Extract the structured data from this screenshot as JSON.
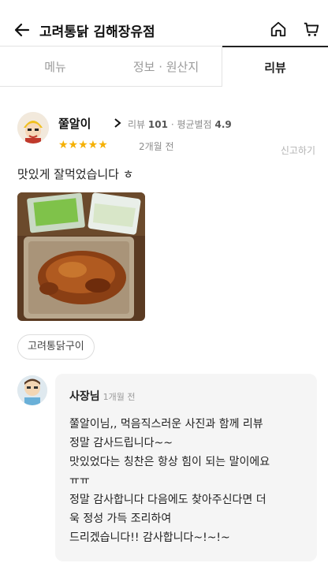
{
  "header": {
    "title": "고려통닭 김해장유점"
  },
  "tabs": [
    {
      "label": "메뉴"
    },
    {
      "label": "정보 · 원산지"
    },
    {
      "label": "리뷰"
    }
  ],
  "review": {
    "nickname": "쭐알이",
    "chevron": ">",
    "review_count_label": "리뷰",
    "review_count": "101",
    "separator": "·",
    "avg_rating_label": "평균별점",
    "avg_rating": "4.9",
    "stars": "★★★★★",
    "date": "2개월 전",
    "report": "신고하기",
    "text": "맛있게 잘먹었습니다 ㅎ",
    "menu_tag": "고려통닭구이"
  },
  "owner_reply": {
    "author": "사장님",
    "date": "1개월 전",
    "text": "쭐알이님,, 먹음직스러운 사진과 함께 리뷰\n정말 감사드립니다~~\n맛있었다는 칭찬은 항상 힘이 되는 말이에요\nㅠㅠ\n정말 감사합니다 다음에도 찾아주신다면 더\n욱 정성 가득 조리하여\n드리겠습니다!! 감사합니다~!~!~"
  },
  "colors": {
    "star": "#f5b000",
    "reply_bg": "#f5f5f5"
  }
}
